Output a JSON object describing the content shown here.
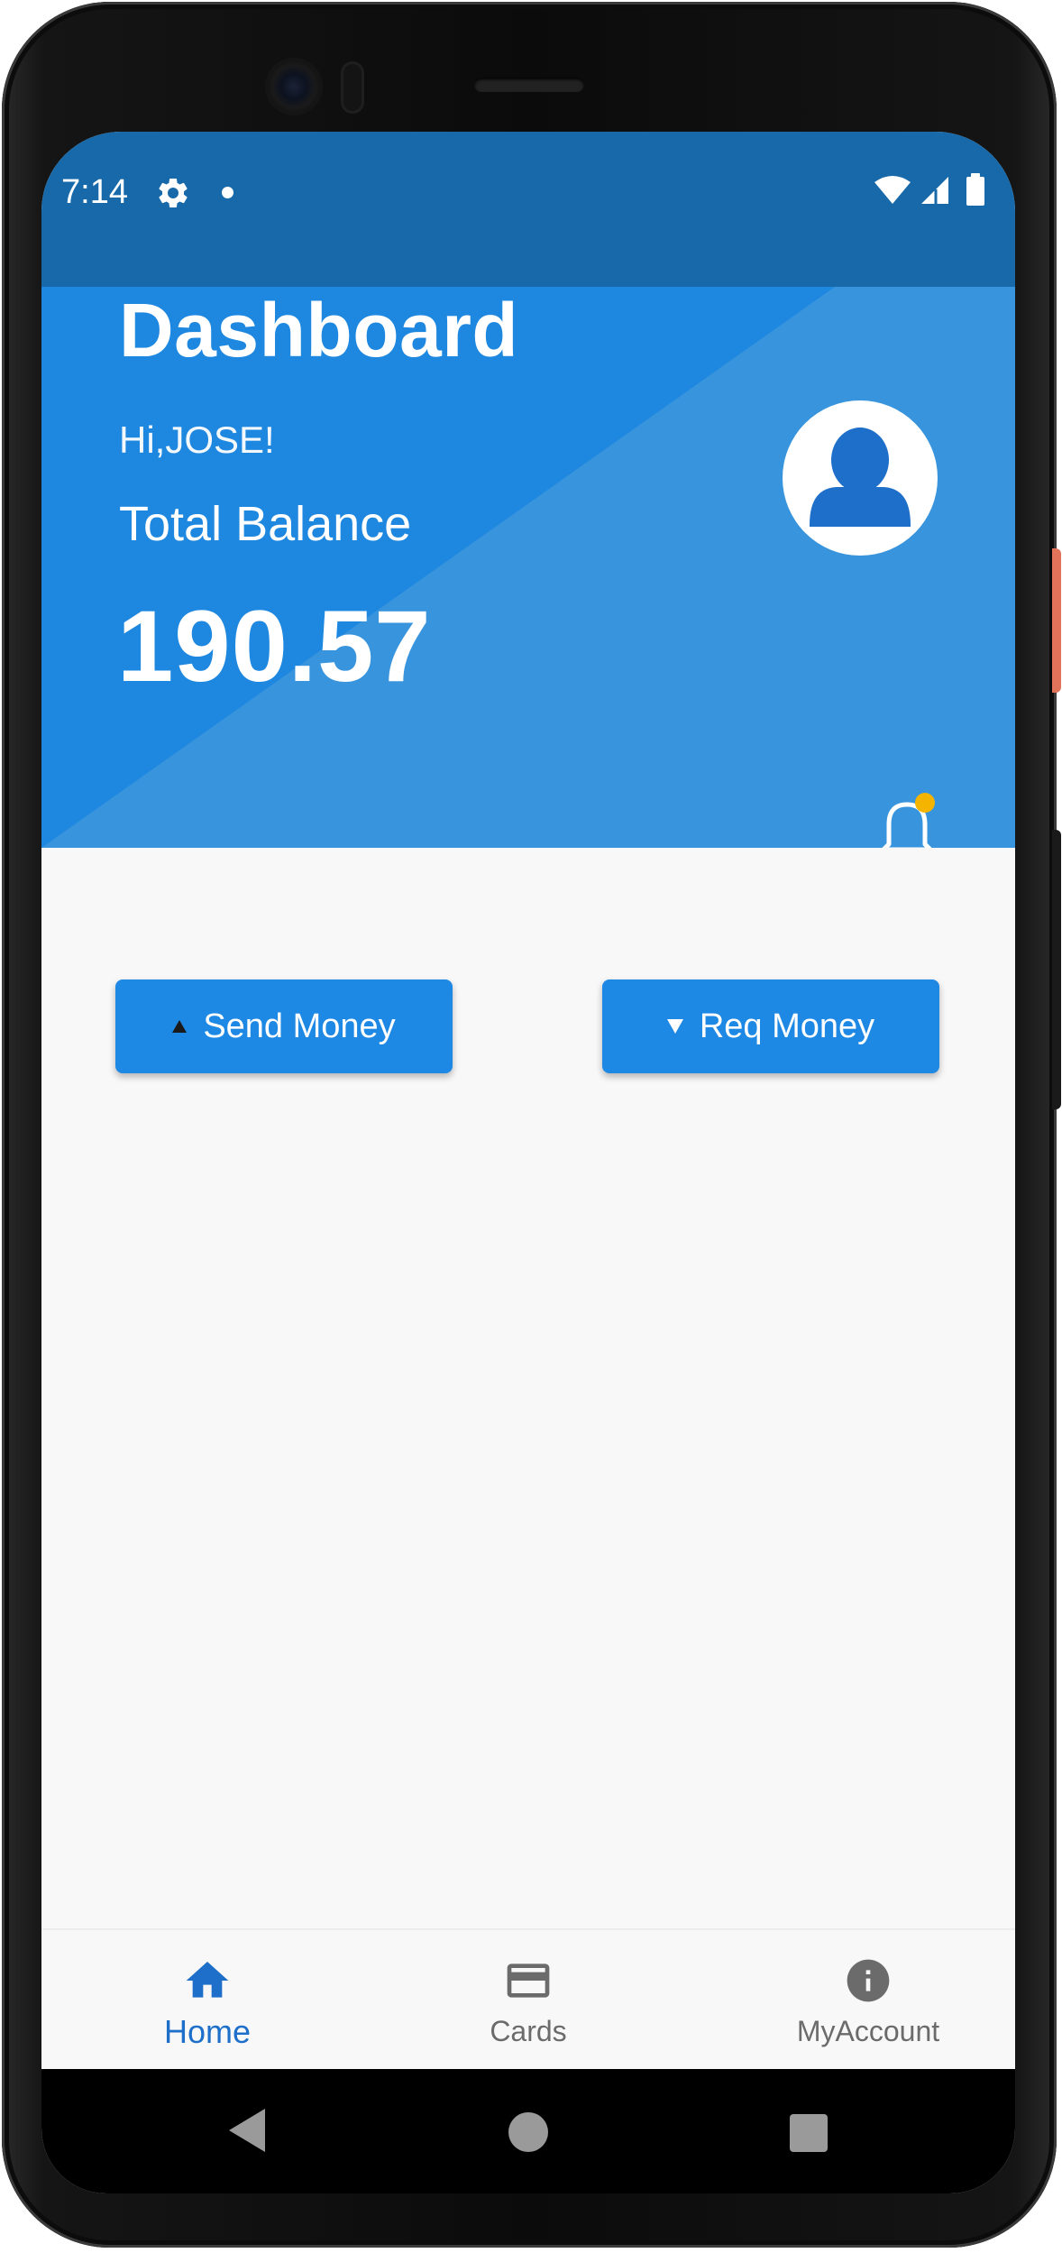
{
  "status_bar": {
    "time": "7:14",
    "icons": [
      "gear-icon",
      "notification-dot-icon",
      "wifi-icon",
      "signal-icon",
      "battery-icon"
    ]
  },
  "header": {
    "title": "Dashboard",
    "greeting": "Hi,JOSE!",
    "balance_label": "Total Balance",
    "balance_value": "190.57",
    "colors": {
      "header_dark": "#1e87df",
      "header_light": "#3894dd",
      "status_bar": "#1769aa",
      "notification_badge": "#f4b400"
    }
  },
  "actions": {
    "send_label": "Send Money",
    "request_label": "Req Money",
    "button_color": "#1e88e5"
  },
  "bottom_nav": {
    "items": [
      {
        "label": "Home",
        "icon": "home-icon",
        "active": true
      },
      {
        "label": "Cards",
        "icon": "credit-card-icon",
        "active": false
      },
      {
        "label": "MyAccount",
        "icon": "info-icon",
        "active": false
      }
    ],
    "active_color": "#1e6fc9",
    "inactive_color": "#6b6b6b"
  },
  "system_nav": {
    "icons": [
      "back-icon",
      "home-circle-icon",
      "recents-icon"
    ]
  }
}
